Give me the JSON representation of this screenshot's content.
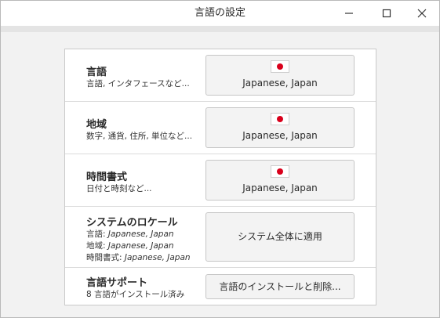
{
  "window": {
    "title": "言語の設定"
  },
  "rows": {
    "language": {
      "title": "言語",
      "subtitle": "言語, インタフェースなど...",
      "button_label": "Japanese, Japan",
      "flag": "japan-flag-icon"
    },
    "region": {
      "title": "地域",
      "subtitle": "数字, 通貨, 住所, 単位など...",
      "button_label": "Japanese, Japan",
      "flag": "japan-flag-icon"
    },
    "time_format": {
      "title": "時間書式",
      "subtitle": "日付と時刻など...",
      "button_label": "Japanese, Japan",
      "flag": "japan-flag-icon"
    },
    "system_locale": {
      "title": "システムのロケール",
      "lines": [
        {
          "key": "言語:",
          "value": "Japanese, Japan"
        },
        {
          "key": "地域:",
          "value": "Japanese, Japan"
        },
        {
          "key": "時間書式:",
          "value": "Japanese, Japan"
        }
      ],
      "button_label": "システム全体に適用"
    },
    "language_support": {
      "title": "言語サポート",
      "subtitle": "8 言語がインストール済み",
      "button_label": "言語のインストールと削除..."
    }
  },
  "colors": {
    "flag_red": "#d9001b",
    "window_bg": "#f2f2f2"
  }
}
